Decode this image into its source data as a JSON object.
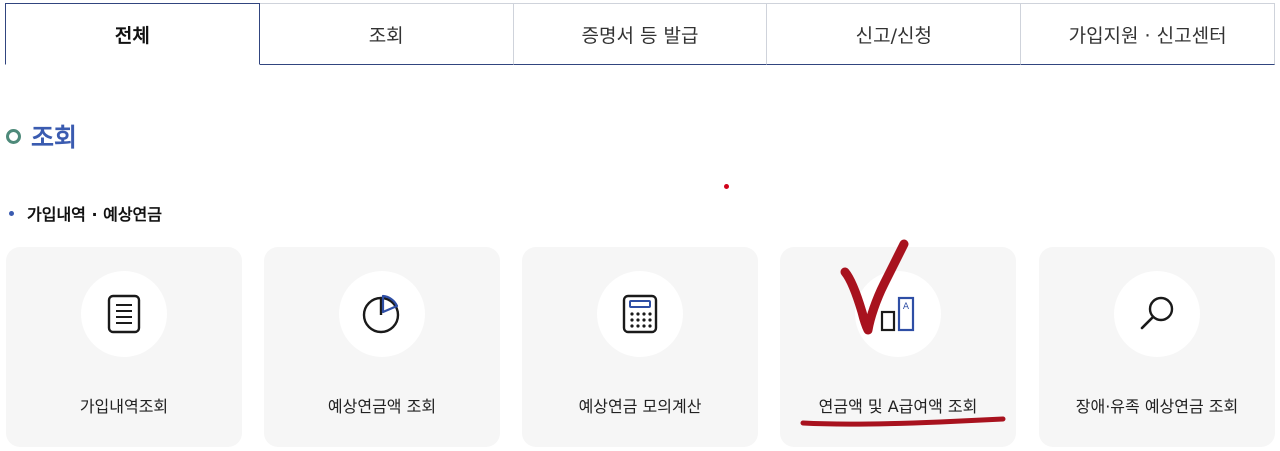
{
  "tabs": [
    {
      "label": "전체",
      "active": true
    },
    {
      "label": "조회",
      "active": false
    },
    {
      "label": "증명서 등 발급",
      "active": false
    },
    {
      "label": "신고/신청",
      "active": false
    },
    {
      "label": "가입지원 · 신고센터",
      "active": false
    }
  ],
  "section": {
    "title": "조회",
    "icon": "ring-bullet-icon"
  },
  "subsection": {
    "title": "가입내역 · 예상연금"
  },
  "cards": [
    {
      "label": "가입내역조회",
      "icon": "document-list-icon"
    },
    {
      "label": "예상연금액 조회",
      "icon": "pie-chart-icon"
    },
    {
      "label": "예상연금 모의계산",
      "icon": "calculator-icon"
    },
    {
      "label": "연금액 및 A급여액 조회",
      "icon": "bar-a-icon"
    },
    {
      "label": "장애·유족 예상연금 조회",
      "icon": "magnifier-icon"
    }
  ],
  "colors": {
    "accent": "#3a5bb0",
    "tab_border": "#31457f",
    "card_bg": "#f6f6f6",
    "annotation_red": "#a8121e"
  }
}
